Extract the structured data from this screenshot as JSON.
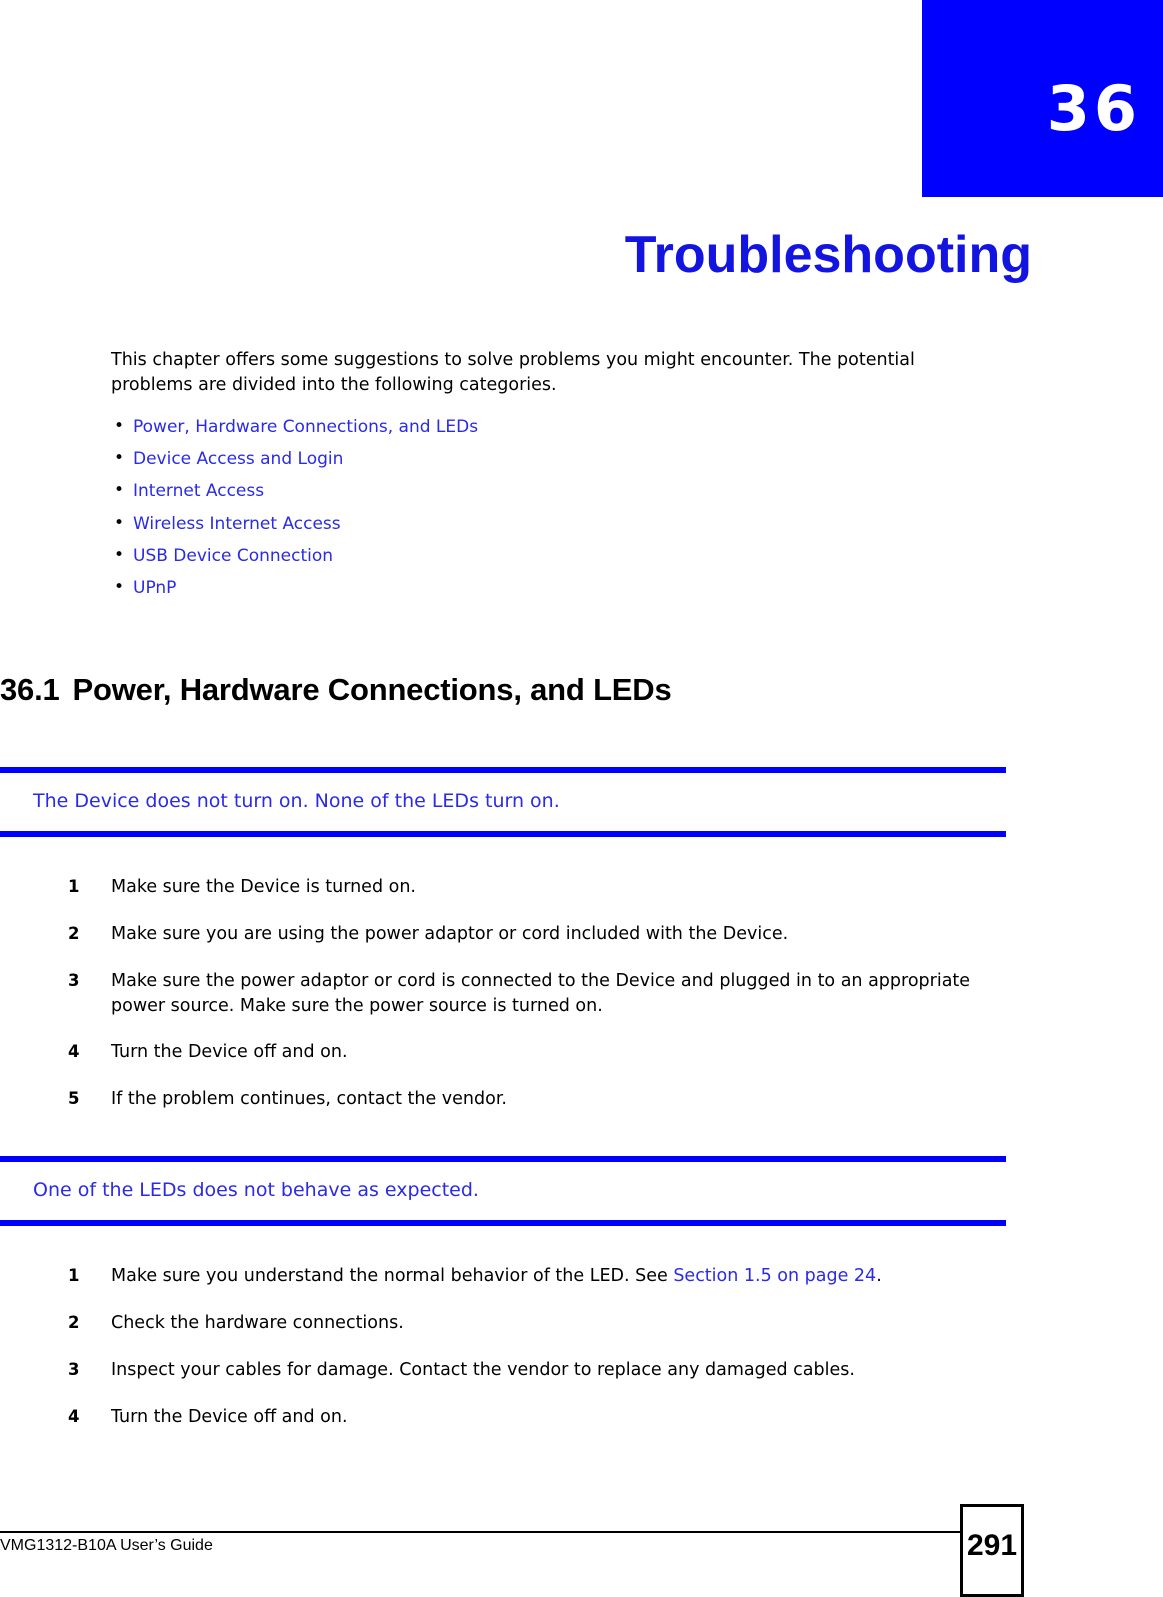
{
  "chapter": {
    "number": "36",
    "title": "Troubleshooting"
  },
  "intro": {
    "paragraph": "This chapter offers some suggestions to solve problems you might encounter. The potential problems are divided into the following categories.",
    "bullet_glyph": "•",
    "links": [
      {
        "label": "Power, Hardware Connections, and LEDs"
      },
      {
        "label": "Device Access and Login"
      },
      {
        "label": "Internet Access"
      },
      {
        "label": "Wireless Internet Access"
      },
      {
        "label": "USB Device Connection"
      },
      {
        "label": "UPnP"
      }
    ]
  },
  "section": {
    "number": "36.1",
    "title": "Power, Hardware Connections, and LEDs"
  },
  "problems": [
    {
      "heading": "The Device does not turn on. None of the LEDs turn on.",
      "steps": [
        {
          "num": "1",
          "text": "Make sure the Device is turned on."
        },
        {
          "num": "2",
          "text": "Make sure you are using the power adaptor or cord included with the Device."
        },
        {
          "num": "3",
          "text": "Make sure the power adaptor or cord is connected to the Device and plugged in to an appropriate power source. Make sure the power source is turned on."
        },
        {
          "num": "4",
          "text": "Turn the Device off and on."
        },
        {
          "num": "5",
          "text": "If the problem continues, contact the vendor."
        }
      ]
    },
    {
      "heading": "One of the LEDs does not behave as expected.",
      "steps": [
        {
          "num": "1",
          "text_before": "Make sure you understand the normal behavior of the LED. See ",
          "xref": "Section 1.5 on page 24",
          "text_after": "."
        },
        {
          "num": "2",
          "text": "Check the hardware connections."
        },
        {
          "num": "3",
          "text": "Inspect your cables for damage. Contact the vendor to replace any damaged cables."
        },
        {
          "num": "4",
          "text": "Turn the Device off and on."
        }
      ]
    }
  ],
  "footer": {
    "guide_name": "VMG1312-B10A User’s Guide",
    "page_number": "291"
  },
  "colors": {
    "chapter_block": "#0000ff",
    "title_blue": "#1414e0",
    "link_blue": "#2a2ae8",
    "rule_blue": "#0000ff"
  }
}
